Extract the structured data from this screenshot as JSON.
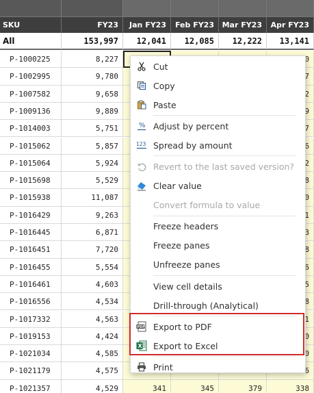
{
  "columns": {
    "sku": "SKU",
    "fy": "FY23",
    "jan": "Jan FY23",
    "feb": "Feb FY23",
    "mar": "Mar FY23",
    "apr": "Apr FY23"
  },
  "all_row": {
    "label": "All",
    "fy": "153,997",
    "jan": "12,041",
    "feb": "12,085",
    "mar": "12,222",
    "apr": "13,141"
  },
  "rows": [
    {
      "sku": "P-1000225",
      "fy": "8,227",
      "jan": "",
      "feb": "",
      "mar": "",
      "apr": "0"
    },
    {
      "sku": "P-1002995",
      "fy": "9,780",
      "jan": "",
      "feb": "",
      "mar": "",
      "apr": "7"
    },
    {
      "sku": "P-1007582",
      "fy": "9,658",
      "jan": "",
      "feb": "",
      "mar": "",
      "apr": "2"
    },
    {
      "sku": "P-1009136",
      "fy": "9,889",
      "jan": "",
      "feb": "",
      "mar": "",
      "apr": "9"
    },
    {
      "sku": "P-1014003",
      "fy": "5,751",
      "jan": "",
      "feb": "",
      "mar": "",
      "apr": "7"
    },
    {
      "sku": "P-1015062",
      "fy": "5,857",
      "jan": "",
      "feb": "",
      "mar": "",
      "apr": "6"
    },
    {
      "sku": "P-1015064",
      "fy": "5,924",
      "jan": "",
      "feb": "",
      "mar": "",
      "apr": "2"
    },
    {
      "sku": "P-1015698",
      "fy": "5,529",
      "jan": "",
      "feb": "",
      "mar": "",
      "apr": "8"
    },
    {
      "sku": "P-1015938",
      "fy": "11,087",
      "jan": "",
      "feb": "",
      "mar": "",
      "apr": "0"
    },
    {
      "sku": "P-1016429",
      "fy": "9,263",
      "jan": "",
      "feb": "",
      "mar": "",
      "apr": "1"
    },
    {
      "sku": "P-1016445",
      "fy": "6,871",
      "jan": "",
      "feb": "",
      "mar": "",
      "apr": "3"
    },
    {
      "sku": "P-1016451",
      "fy": "7,720",
      "jan": "",
      "feb": "",
      "mar": "",
      "apr": "8"
    },
    {
      "sku": "P-1016455",
      "fy": "5,554",
      "jan": "",
      "feb": "",
      "mar": "",
      "apr": "6"
    },
    {
      "sku": "P-1016461",
      "fy": "4,603",
      "jan": "",
      "feb": "",
      "mar": "",
      "apr": "5"
    },
    {
      "sku": "P-1016556",
      "fy": "4,534",
      "jan": "",
      "feb": "",
      "mar": "",
      "apr": "8"
    },
    {
      "sku": "P-1017332",
      "fy": "4,563",
      "jan": "",
      "feb": "",
      "mar": "",
      "apr": "1"
    },
    {
      "sku": "P-1019153",
      "fy": "4,424",
      "jan": "",
      "feb": "",
      "mar": "",
      "apr": "0"
    },
    {
      "sku": "P-1021034",
      "fy": "4,585",
      "jan": "",
      "feb": "",
      "mar": "",
      "apr": "0"
    },
    {
      "sku": "P-1021179",
      "fy": "4,575",
      "jan": "",
      "feb": "",
      "mar": "",
      "apr": "6"
    },
    {
      "sku": "P-1021357",
      "fy": "4,529",
      "jan": "341",
      "feb": "345",
      "mar": "379",
      "apr": "338"
    }
  ],
  "menu": {
    "cut": "Cut",
    "copy": "Copy",
    "paste": "Paste",
    "adjust": "Adjust by percent",
    "spread": "Spread by amount",
    "revert": "Revert to the last saved version?",
    "clear": "Clear value",
    "convert": "Convert formula to value",
    "freeze_headers": "Freeze headers",
    "freeze_panes": "Freeze panes",
    "unfreeze": "Unfreeze panes",
    "view_details": "View cell details",
    "drill": "Drill-through (Analytical)",
    "export_pdf": "Export to PDF",
    "export_excel": "Export to Excel",
    "print": "Print",
    "icons": {
      "cut": "scissors-icon",
      "copy": "copy-icon",
      "paste": "paste-icon",
      "adjust": "percent-icon",
      "spread": "spread-123-icon",
      "revert": "undo-icon",
      "clear": "eraser-icon",
      "pdf": "pdf-icon",
      "excel": "excel-icon",
      "print": "printer-icon"
    }
  },
  "colors": {
    "header_bg": "#3e3e3e",
    "month_cell_bg": "#fdfbd6",
    "highlight_border": "#d22a2a"
  }
}
